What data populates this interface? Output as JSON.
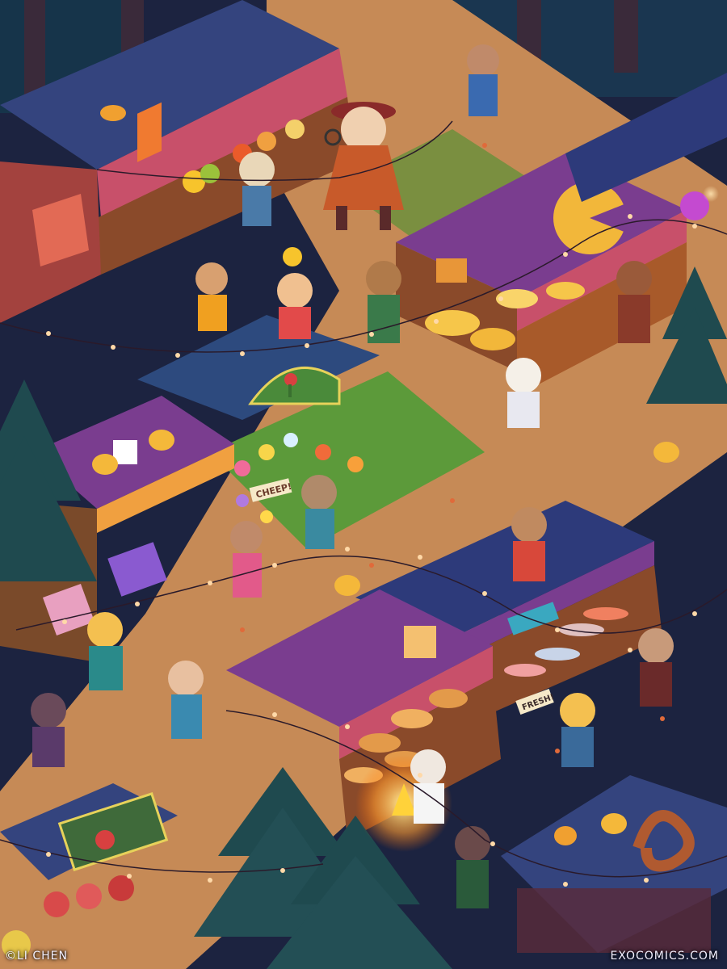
{
  "illustration": {
    "credit_left": "©LI CHEN",
    "credit_right": "EXOCOMICS.COM",
    "sign_cheep": "CHEEP!",
    "sign_fresh": "FRESH!"
  },
  "colors": {
    "night_sky": "#1c1f3a",
    "forest": "#1f4a4f",
    "ground": "#c9925e",
    "grass": "#5f9a3a",
    "awning_blue": "#34447e",
    "awning_purple": "#7a3d8f",
    "awning_pink": "#c8506a",
    "wood": "#8a4a2a",
    "cheese": "#f2b73a",
    "bread": "#e39a4a",
    "lights": "#ffd9a8"
  }
}
